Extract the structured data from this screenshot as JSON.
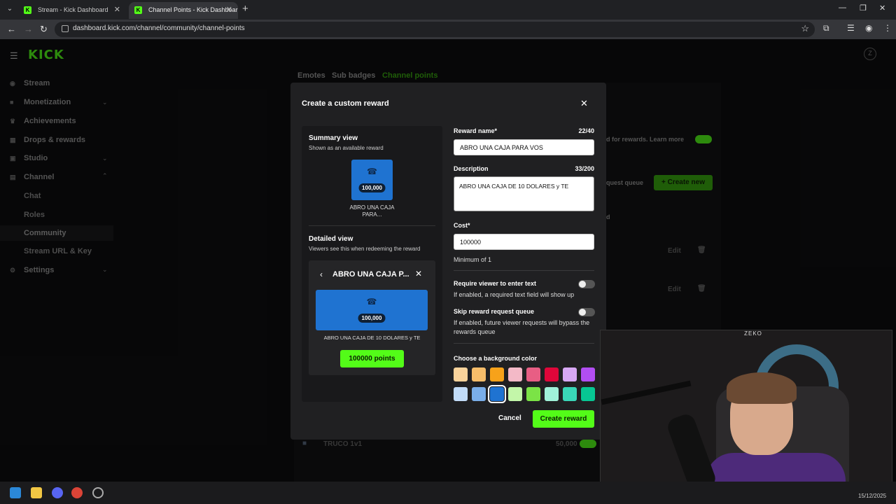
{
  "browser": {
    "tabs": [
      {
        "title": "Stream - Kick Dashboard"
      },
      {
        "title": "Channel Points - Kick Dashboar"
      }
    ],
    "url": "dashboard.kick.com/channel/community/channel-points"
  },
  "app": {
    "logo": "KICK",
    "sidebar": {
      "items": [
        {
          "label": "Stream"
        },
        {
          "label": "Monetization"
        },
        {
          "label": "Achievements"
        },
        {
          "label": "Drops & rewards"
        },
        {
          "label": "Studio"
        },
        {
          "label": "Channel"
        },
        {
          "label": "Chat"
        },
        {
          "label": "Roles"
        },
        {
          "label": "Community"
        },
        {
          "label": "Stream URL & Key"
        },
        {
          "label": "Settings"
        }
      ]
    },
    "top_tabs": [
      "Emotes",
      "Sub badges",
      "Channel points"
    ],
    "background": {
      "rewards_text": "d for rewards. Learn more",
      "queue_text": "quest queue",
      "create_new": "+ Create new",
      "row_label": "TRUCO 1v1",
      "row_cost": "50,000",
      "edit_label": "Edit",
      "d_char": "d"
    }
  },
  "modal": {
    "title": "Create a custom reward",
    "summary": {
      "heading": "Summary view",
      "subheading": "Shown as an available reward",
      "tile_cost": "100,000",
      "tile_name": "ABRO UNA CAJA PARA..."
    },
    "detailed": {
      "heading": "Detailed view",
      "subheading": "Viewers see this when redeeming the reward",
      "title": "ABRO UNA CAJA P...",
      "banner_cost": "100,000",
      "description": "ABRO UNA CAJA DE 10 DOLARES y TE",
      "points_button": "100000 points"
    },
    "form": {
      "reward_name_label": "Reward name*",
      "reward_name_count": "22/40",
      "reward_name_value": "ABRO UNA CAJA PARA VOS",
      "description_label": "Description",
      "description_count": "33/200",
      "description_value": "ABRO UNA CAJA DE 10 DOLARES y TE",
      "cost_label": "Cost*",
      "cost_value": "100000",
      "cost_hint": "Minimum of 1",
      "require_text_label": "Require viewer to enter text",
      "require_text_hint": "If enabled, a required text field will show up",
      "require_text_enabled": false,
      "skip_queue_label": "Skip reward request queue",
      "skip_queue_hint": "If enabled, future viewer requests will bypass the rewards queue",
      "skip_queue_enabled": false,
      "color_label": "Choose a background color",
      "colors": [
        "#f9d39b",
        "#f6bd6a",
        "#f7a21a",
        "#f3b9c7",
        "#e85e84",
        "#e0063a",
        "#d7a8f4",
        "#b14ef2",
        "#c2dcf8",
        "#7aaee9",
        "#1f73d1",
        "#c3f6a9",
        "#7be346",
        "#a0f2d9",
        "#3ad7b8",
        "#07c693"
      ],
      "selected_color": "#1f73d1"
    },
    "buttons": {
      "cancel": "Cancel",
      "create": "Create reward"
    }
  },
  "webcam": {
    "overlay_text": "ZEKO"
  },
  "taskbar": {
    "date": "15/12/2025"
  }
}
